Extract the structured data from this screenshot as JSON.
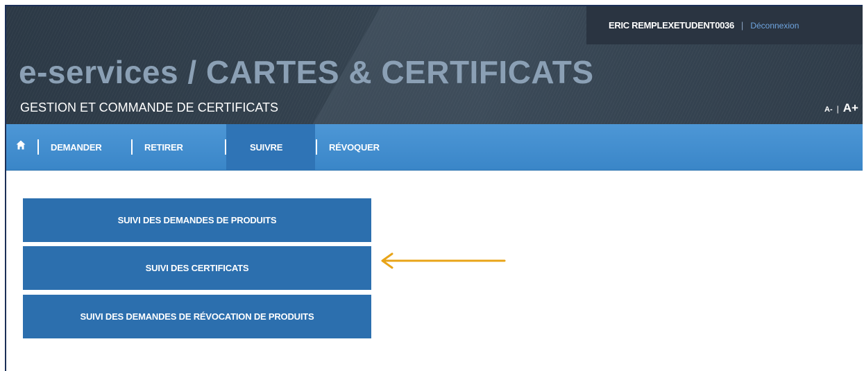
{
  "header": {
    "title": "e-services / CARTES & CERTIFICATS",
    "subtitle": "GESTION ET COMMANDE DE CERTIFICATS",
    "user": {
      "name": "ERIC REMPLEXETUDENT0036",
      "separator": "|",
      "logout_label": "Déconnexion"
    },
    "font_size": {
      "decrease": "A-",
      "separator": "|",
      "increase": "A+"
    }
  },
  "nav": {
    "home_icon": "home-icon",
    "items": [
      {
        "label": "DEMANDER",
        "active": false
      },
      {
        "label": "RETIRER",
        "active": false
      },
      {
        "label": "SUIVRE",
        "active": true
      },
      {
        "label": "RÉVOQUER",
        "active": false
      }
    ]
  },
  "menu": {
    "items": [
      {
        "label": "SUIVI DES DEMANDES DE PRODUITS"
      },
      {
        "label": "SUIVI DES CERTIFICATS"
      },
      {
        "label": "SUIVI DES DEMANDES DE RÉVOCATION DE PRODUITS"
      }
    ]
  },
  "annotation": {
    "type": "arrow",
    "target": "SUIVI DES CERTIFICATS",
    "color": "#e8a418"
  },
  "colors": {
    "header_bg": "#34424f",
    "title": "#8ba0b5",
    "nav_bg": "#3f8bcd",
    "nav_active": "#2f74b6",
    "menu_button": "#2c6fae",
    "logout_link": "#6fa5e0"
  }
}
